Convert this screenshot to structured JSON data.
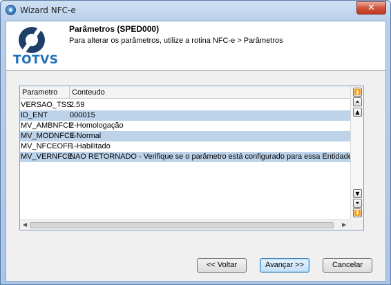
{
  "window": {
    "title": "Wizard NFC-e",
    "close_label": "✕"
  },
  "header": {
    "logo_text": "TOTVS",
    "title": "Parâmetros (SPED000)",
    "subtitle": "Para alterar os parâmetros, utilize a rotina NFC-e > Parâmetros"
  },
  "grid": {
    "columns": [
      "Parametro",
      "Conteudo"
    ],
    "rows": [
      {
        "param": "VERSAO_TSS",
        "value": "2.59"
      },
      {
        "param": "ID_ENT",
        "value": "000015"
      },
      {
        "param": "MV_AMBNFCE",
        "value": "2-Homologação"
      },
      {
        "param": "MV_MODNFCE",
        "value": "1-Normal"
      },
      {
        "param": "MV_NFCEOFF",
        "value": "1-Habilitado"
      },
      {
        "param": "MV_VERNFCE",
        "value": "NAO RETORNADO - Verifique se o parâmetro está configurado para essa Entidade na tabel"
      }
    ]
  },
  "buttons": {
    "back": "<< Voltar",
    "next": "Avançar >>",
    "cancel": "Cancelar"
  }
}
